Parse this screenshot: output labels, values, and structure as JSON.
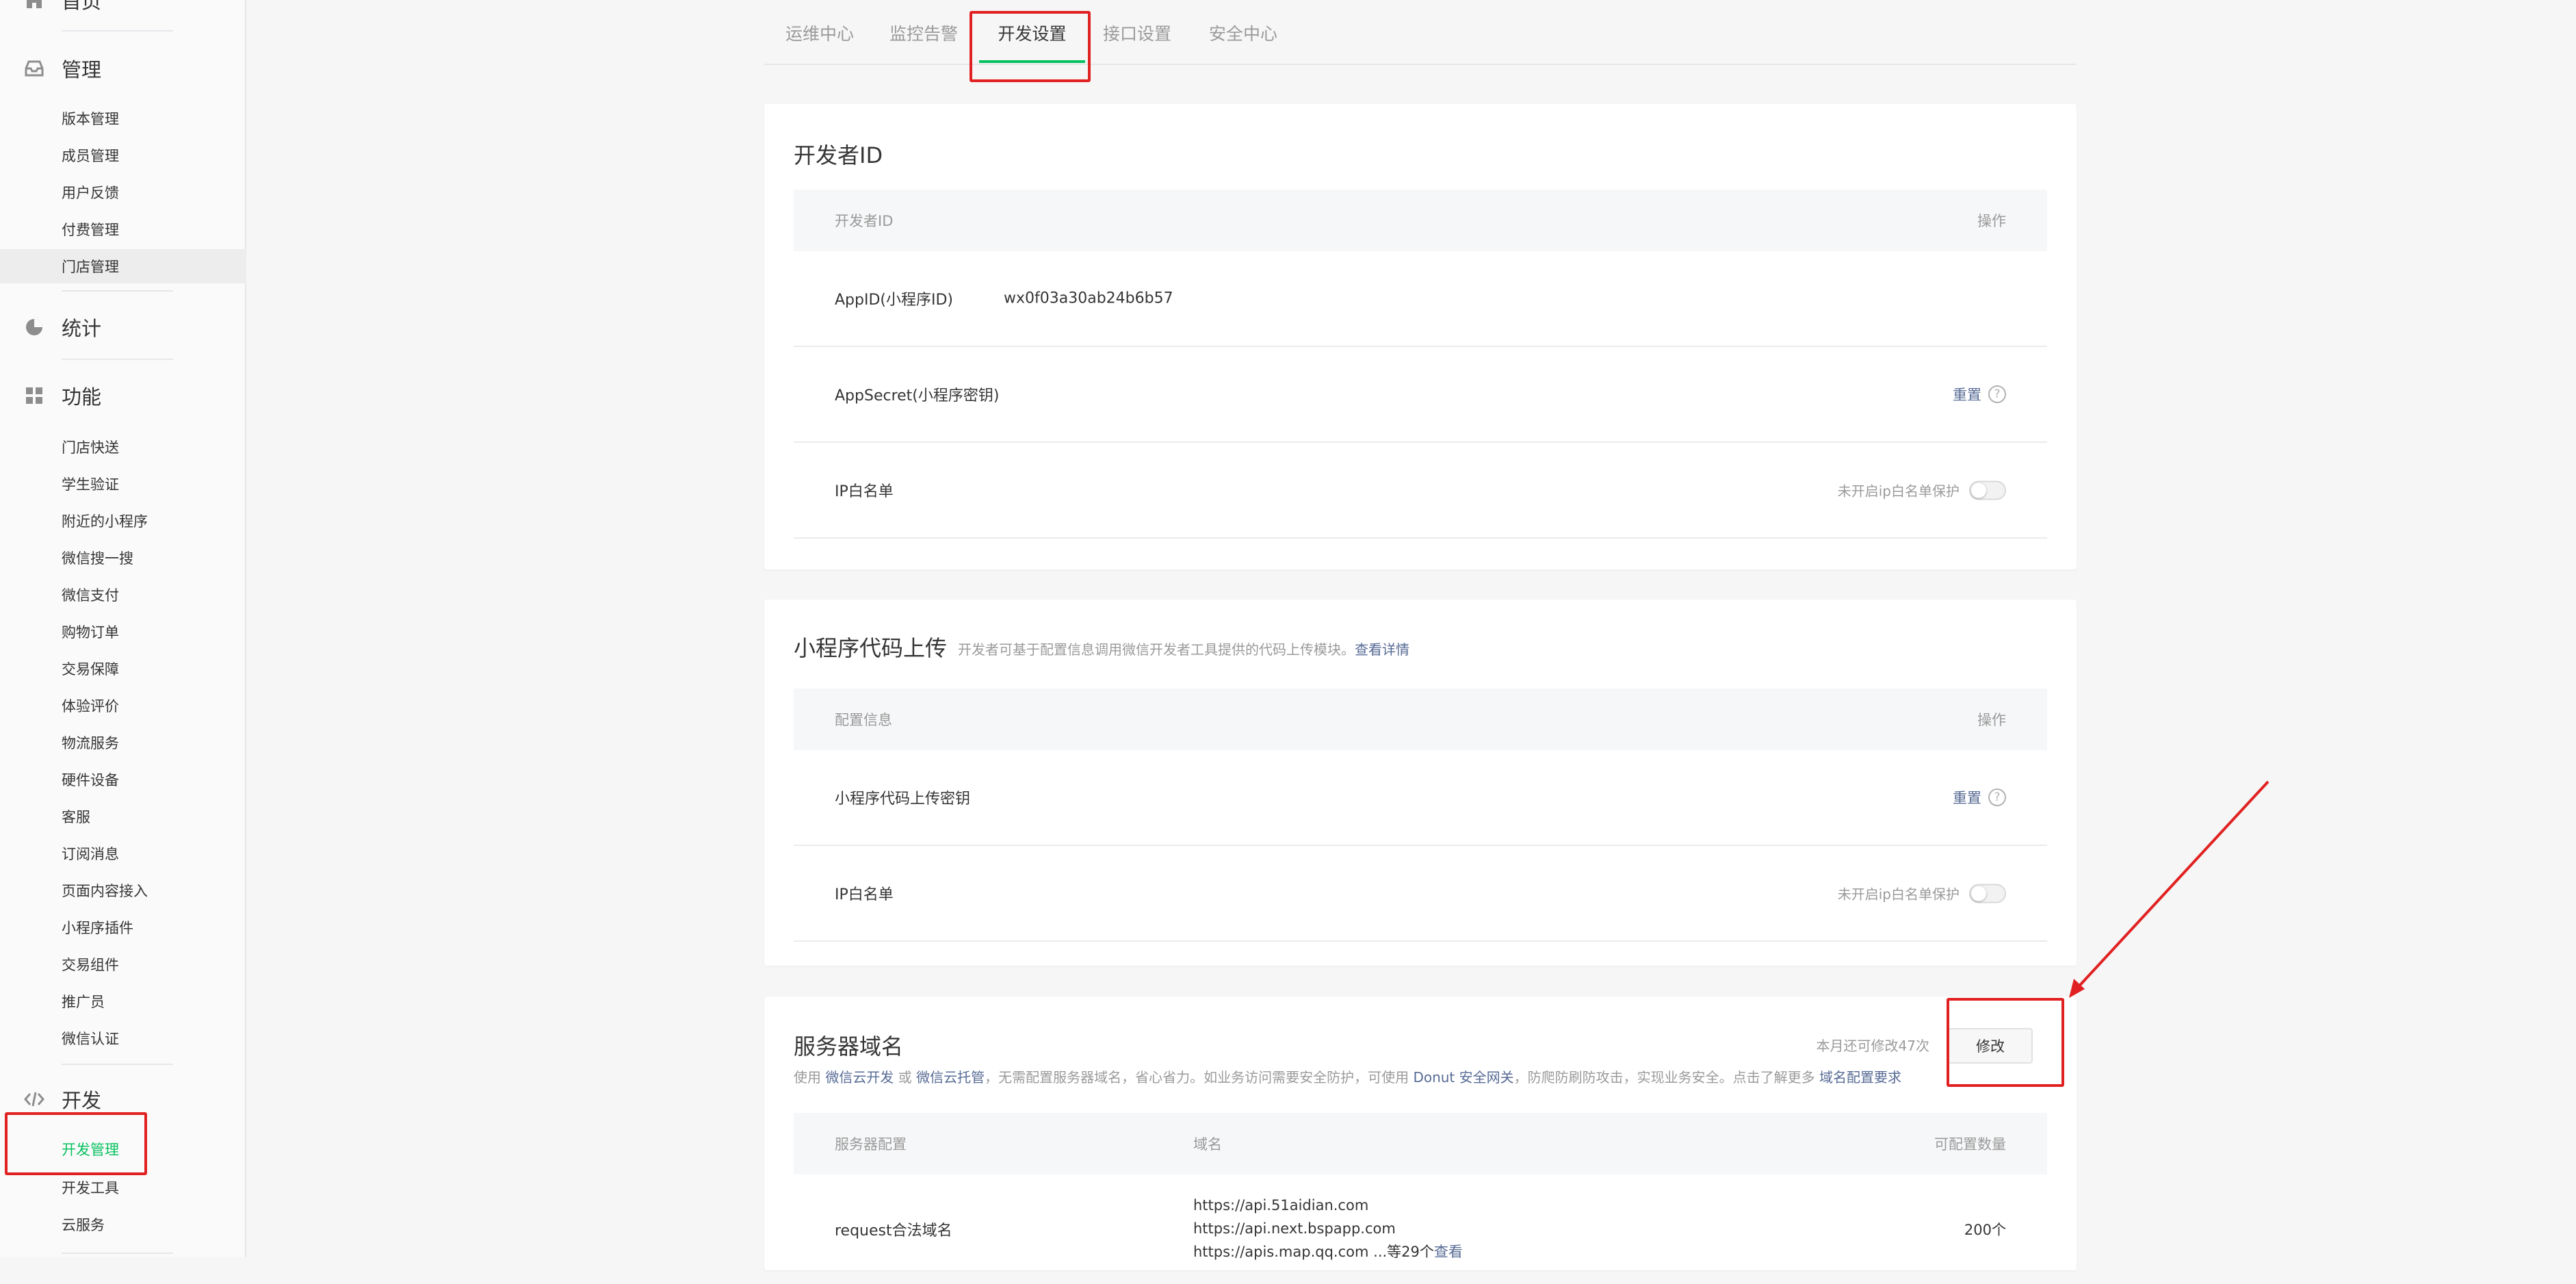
{
  "sidebar": {
    "home": {
      "label": "首页",
      "icon": "home-icon"
    },
    "manage": {
      "label": "管理",
      "icon": "inbox-icon",
      "items": [
        "版本管理",
        "成员管理",
        "用户反馈",
        "付费管理",
        "门店管理"
      ]
    },
    "stats": {
      "label": "统计",
      "icon": "pie-chart-icon"
    },
    "features": {
      "label": "功能",
      "icon": "grid-icon",
      "items": [
        "门店快送",
        "学生验证",
        "附近的小程序",
        "微信搜一搜",
        "微信支付",
        "购物订单",
        "交易保障",
        "体验评价",
        "物流服务",
        "硬件设备",
        "客服",
        "订阅消息",
        "页面内容接入",
        "小程序插件",
        "交易组件",
        "推广员",
        "微信认证"
      ]
    },
    "dev": {
      "label": "开发",
      "icon": "code-icon",
      "items": [
        "开发管理",
        "开发工具",
        "云服务"
      ]
    }
  },
  "tabs": [
    "运维中心",
    "监控告警",
    "开发设置",
    "接口设置",
    "安全中心"
  ],
  "developer_id": {
    "title": "开发者ID",
    "col_left": "开发者ID",
    "col_right": "操作",
    "appid_label": "AppID(小程序ID)",
    "appid_value": "wx0f03a30ab24b6b57",
    "secret_label": "AppSecret(小程序密钥)",
    "secret_action": "重置",
    "ip_label": "IP白名单",
    "ip_status": "未开启ip白名单保护"
  },
  "code_upload": {
    "title": "小程序代码上传",
    "desc": "开发者可基于配置信息调用微信开发者工具提供的代码上传模块。",
    "desc_link": "查看详情",
    "col_left": "配置信息",
    "col_right": "操作",
    "key_label": "小程序代码上传密钥",
    "key_action": "重置",
    "ip_label": "IP白名单",
    "ip_status": "未开启ip白名单保护"
  },
  "server_domain": {
    "title": "服务器域名",
    "remaining": "本月还可修改47次",
    "modify_button": "修改",
    "desc_1": "使用",
    "link_1": "微信云开发",
    "desc_2": "或",
    "link_2": "微信云托管",
    "desc_3": "，无需配置服务器域名，省心省力。如业务访问需要安全防护，可使用",
    "link_3": "Donut 安全网关",
    "desc_4": "，防爬防刷防攻击，实现业务安全。点击了解更多",
    "link_4": "域名配置要求",
    "col_1": "服务器配置",
    "col_2": "域名",
    "col_3": "可配置数量",
    "request_label": "request合法域名",
    "domains": [
      "https://api.51aidian.com",
      "https://api.next.bspapp.com",
      "https://apis.map.qq.com"
    ],
    "more_text": "...等29个",
    "more_link": "查看",
    "request_count": "200个"
  },
  "colors": {
    "accent": "#07c160",
    "link": "#576b95",
    "highlight": "#e12121"
  }
}
